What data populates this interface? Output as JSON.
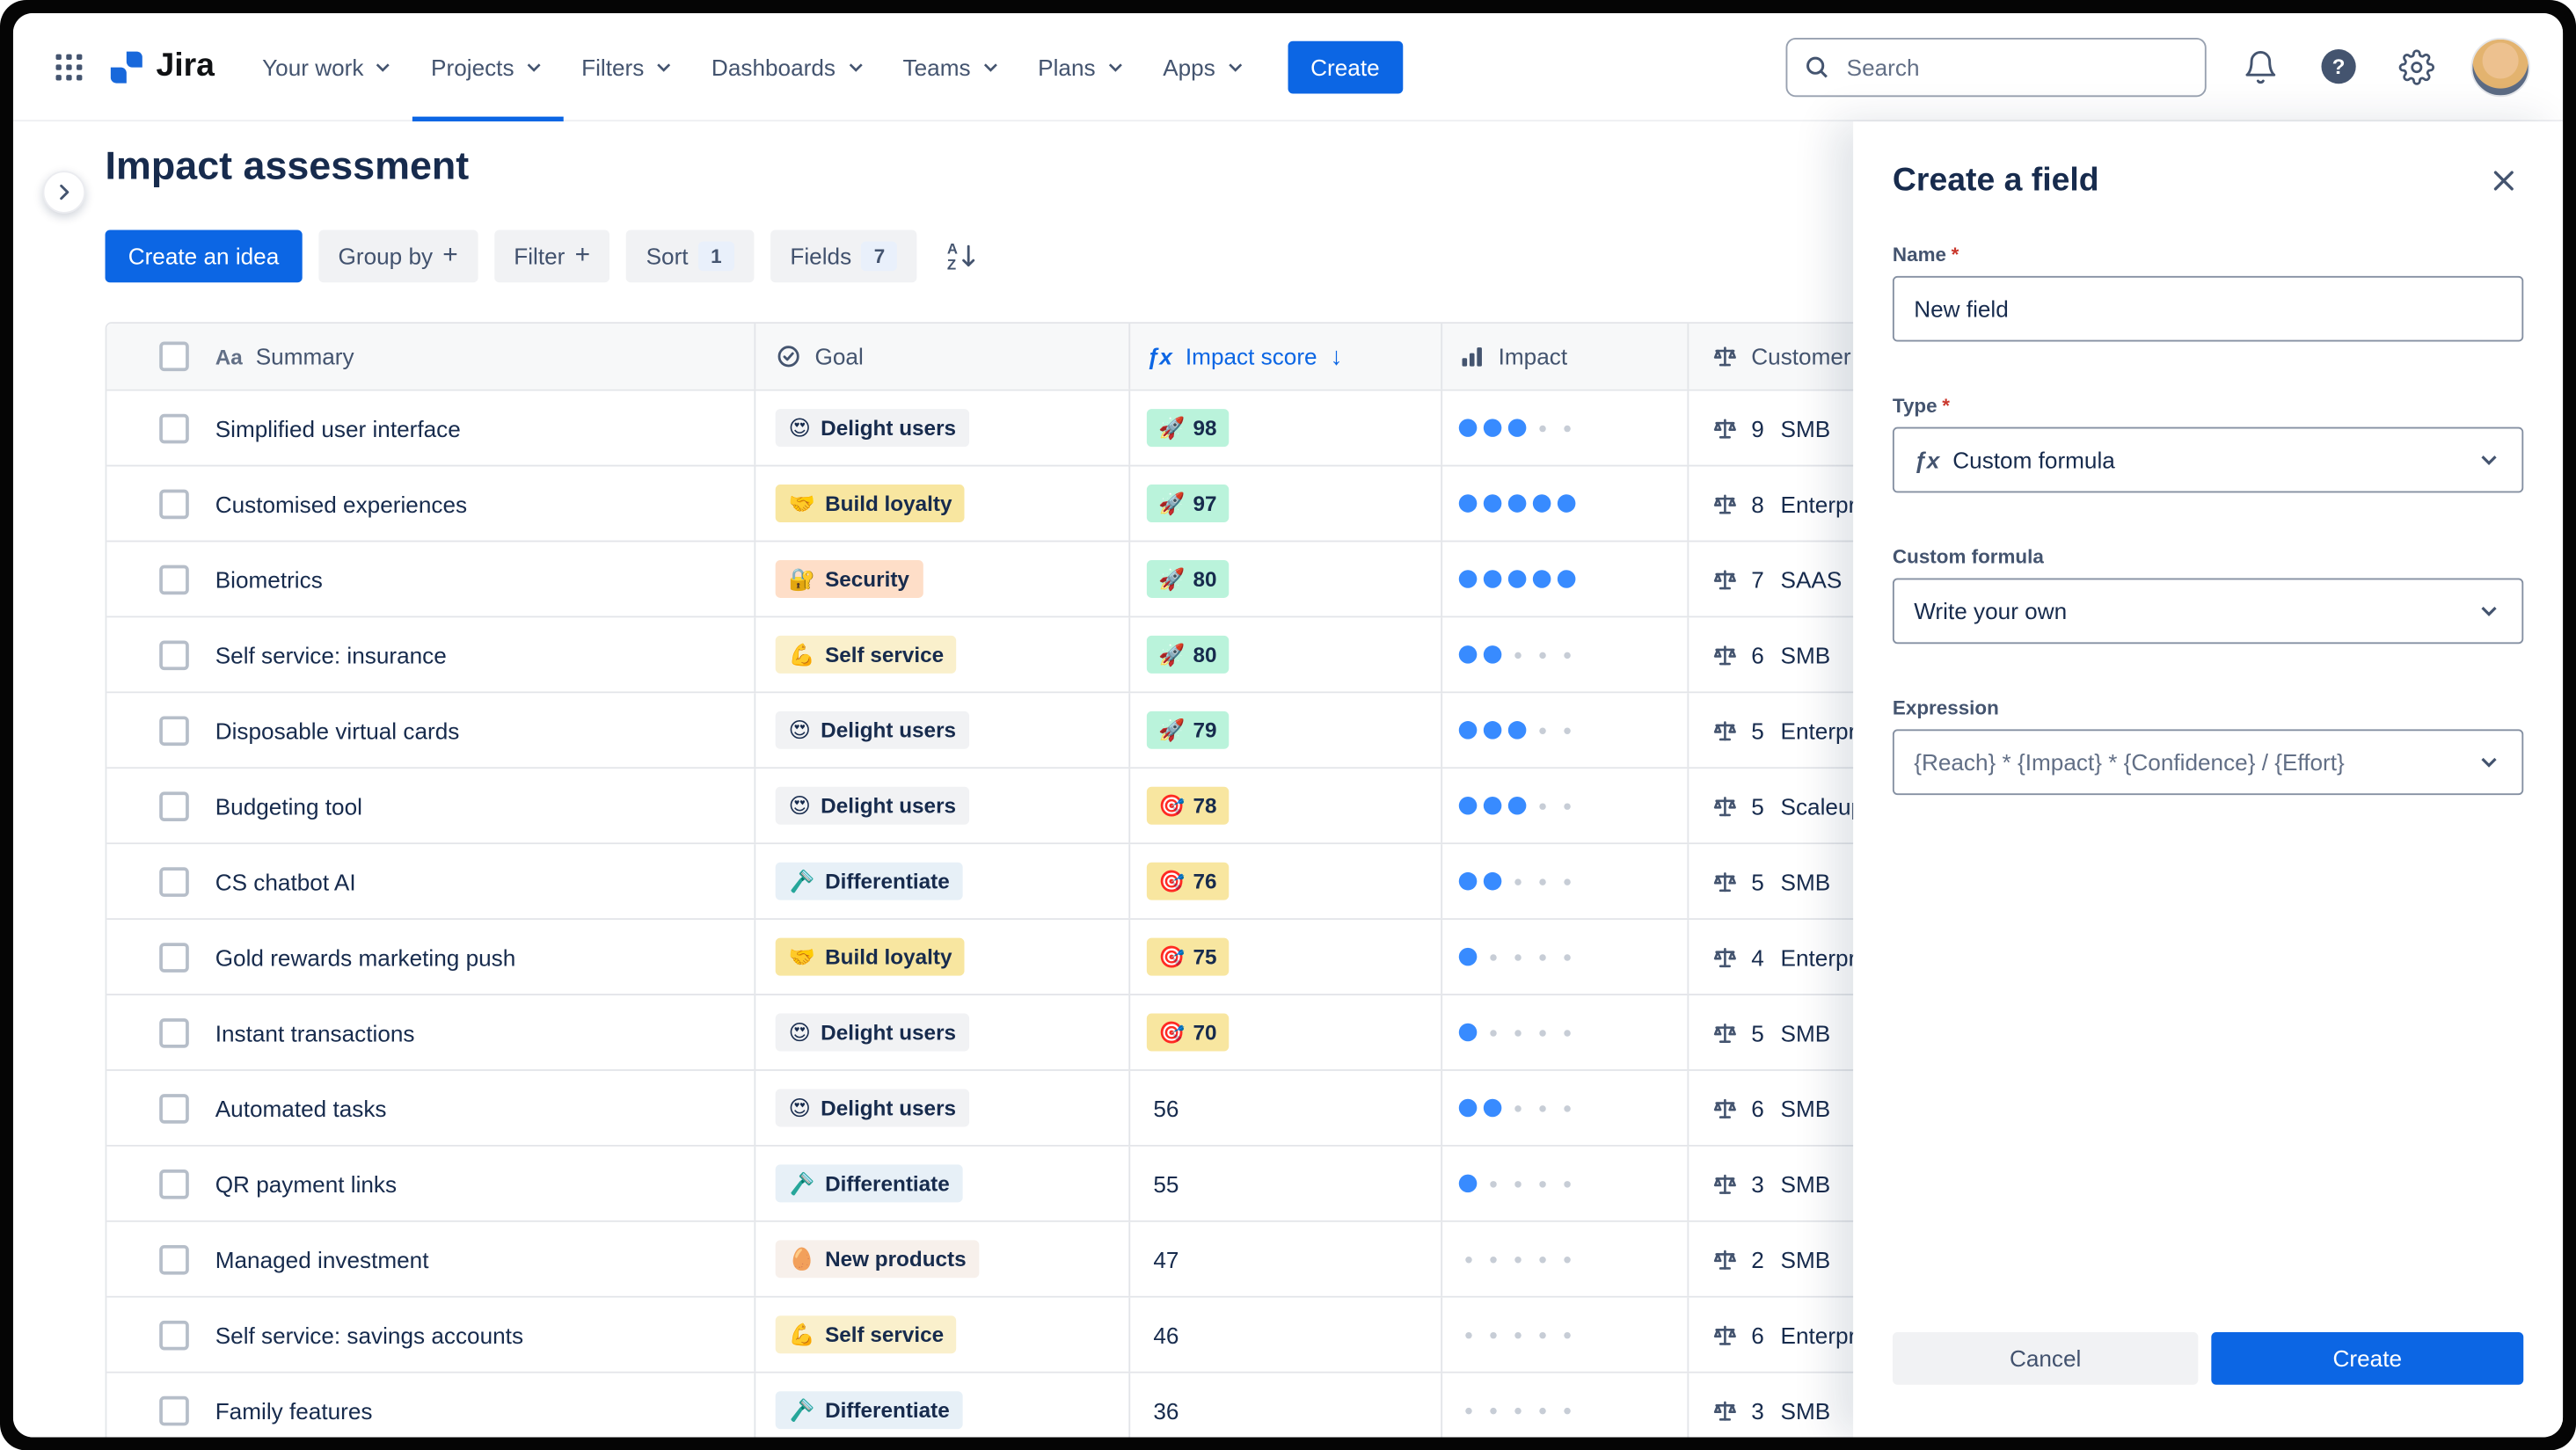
{
  "nav": {
    "logo": "Jira",
    "items": [
      {
        "label": "Your work",
        "active": false
      },
      {
        "label": "Projects",
        "active": true
      },
      {
        "label": "Filters",
        "active": false
      },
      {
        "label": "Dashboards",
        "active": false
      },
      {
        "label": "Teams",
        "active": false
      },
      {
        "label": "Plans",
        "active": false
      },
      {
        "label": "Apps",
        "active": false
      }
    ],
    "create_button": "Create",
    "search_placeholder": "Search"
  },
  "page": {
    "title": "Impact assessment"
  },
  "toolbar": {
    "create_idea_button": "Create an idea",
    "group_by_button": "Group by",
    "filter_button": "Filter",
    "sort_button": "Sort",
    "sort_badge": "1",
    "fields_button": "Fields",
    "fields_badge": "7",
    "plus": "+"
  },
  "table": {
    "headers": {
      "summary_icon": "Aa",
      "summary": "Summary",
      "goal": "Goal",
      "formula_icon": "ƒx",
      "impact_score": "Impact score",
      "sort_arrow": "↓",
      "impact": "Impact",
      "customer": "Customer"
    },
    "rows": [
      {
        "summary": "Simplified user interface",
        "goal_emoji": "😍",
        "goal": "Delight users",
        "goal_bg": "#F1F2F4",
        "score_emoji": "🚀",
        "score": "98",
        "score_bg": "#BAF3DB",
        "impact": 3,
        "customer_value": "9",
        "customer_segment": "SMB"
      },
      {
        "summary": "Customised experiences",
        "goal_emoji": "🤝",
        "goal": "Build loyalty",
        "goal_bg": "#F8E6A0",
        "score_emoji": "🚀",
        "score": "97",
        "score_bg": "#BAF3DB",
        "impact": 5,
        "customer_value": "8",
        "customer_segment": "Enterprise"
      },
      {
        "summary": "Biometrics",
        "goal_emoji": "🔐",
        "goal": "Security",
        "goal_bg": "#FEDEC8",
        "score_emoji": "🚀",
        "score": "80",
        "score_bg": "#BAF3DB",
        "impact": 5,
        "customer_value": "7",
        "customer_segment": "SAAS"
      },
      {
        "summary": "Self service: insurance",
        "goal_emoji": "💪",
        "goal": "Self service",
        "goal_bg": "#FAF0CC",
        "score_emoji": "🚀",
        "score": "80",
        "score_bg": "#BAF3DB",
        "impact": 2,
        "customer_value": "6",
        "customer_segment": "SMB"
      },
      {
        "summary": "Disposable virtual cards",
        "goal_emoji": "😍",
        "goal": "Delight users",
        "goal_bg": "#F1F2F4",
        "score_emoji": "🚀",
        "score": "79",
        "score_bg": "#BAF3DB",
        "impact": 3,
        "customer_value": "5",
        "customer_segment": "Enterprise"
      },
      {
        "summary": "Budgeting tool",
        "goal_emoji": "😍",
        "goal": "Delight users",
        "goal_bg": "#F1F2F4",
        "score_emoji": "🎯",
        "score": "78",
        "score_bg": "#F8E6A0",
        "impact": 3,
        "customer_value": "5",
        "customer_segment": "Scaleups"
      },
      {
        "summary": "CS chatbot AI",
        "goal_emoji": "🪒",
        "goal": "Differentiate",
        "goal_bg": "#E7F0F7",
        "score_emoji": "🎯",
        "score": "76",
        "score_bg": "#F8E6A0",
        "impact": 2,
        "customer_value": "5",
        "customer_segment": "SMB"
      },
      {
        "summary": "Gold rewards marketing push",
        "goal_emoji": "🤝",
        "goal": "Build loyalty",
        "goal_bg": "#F8E6A0",
        "score_emoji": "🎯",
        "score": "75",
        "score_bg": "#F8E6A0",
        "impact": 1,
        "customer_value": "4",
        "customer_segment": "Enterprise"
      },
      {
        "summary": "Instant transactions",
        "goal_emoji": "😍",
        "goal": "Delight users",
        "goal_bg": "#F1F2F4",
        "score_emoji": "🎯",
        "score": "70",
        "score_bg": "#F8E6A0",
        "impact": 1,
        "customer_value": "5",
        "customer_segment": "SMB"
      },
      {
        "summary": "Automated tasks",
        "goal_emoji": "😍",
        "goal": "Delight users",
        "goal_bg": "#F1F2F4",
        "score_emoji": "",
        "score": "56",
        "score_bg": "",
        "impact": 2,
        "customer_value": "6",
        "customer_segment": "SMB"
      },
      {
        "summary": "QR payment links",
        "goal_emoji": "🪒",
        "goal": "Differentiate",
        "goal_bg": "#E7F0F7",
        "score_emoji": "",
        "score": "55",
        "score_bg": "",
        "impact": 1,
        "customer_value": "3",
        "customer_segment": "SMB"
      },
      {
        "summary": "Managed investment",
        "goal_emoji": "🥚",
        "goal": "New products",
        "goal_bg": "#F7F0EB",
        "score_emoji": "",
        "score": "47",
        "score_bg": "",
        "impact": 0,
        "customer_value": "2",
        "customer_segment": "SMB"
      },
      {
        "summary": "Self service: savings accounts",
        "goal_emoji": "💪",
        "goal": "Self service",
        "goal_bg": "#FAF0CC",
        "score_emoji": "",
        "score": "46",
        "score_bg": "",
        "impact": 0,
        "customer_value": "6",
        "customer_segment": "Enterprise"
      },
      {
        "summary": "Family features",
        "goal_emoji": "🪒",
        "goal": "Differentiate",
        "goal_bg": "#E7F0F7",
        "score_emoji": "",
        "score": "36",
        "score_bg": "",
        "impact": 0,
        "customer_value": "3",
        "customer_segment": "SMB"
      }
    ]
  },
  "panel": {
    "title": "Create a field",
    "required_marker": "*",
    "name_label": "Name",
    "name_value": "New field",
    "type_label": "Type",
    "type_icon": "ƒx",
    "type_value": "Custom formula",
    "custom_formula_label": "Custom formula",
    "custom_formula_value": "Write your own",
    "expression_label": "Expression",
    "expression_value": "{Reach} * {Impact} * {Confidence} / {Effort}",
    "cancel_button": "Cancel",
    "create_button": "Create"
  },
  "colors": {
    "accent": "#0C66E4",
    "impact_dot": "#388BFF",
    "score_high_bg": "#BAF3DB",
    "score_mid_bg": "#F8E6A0"
  }
}
